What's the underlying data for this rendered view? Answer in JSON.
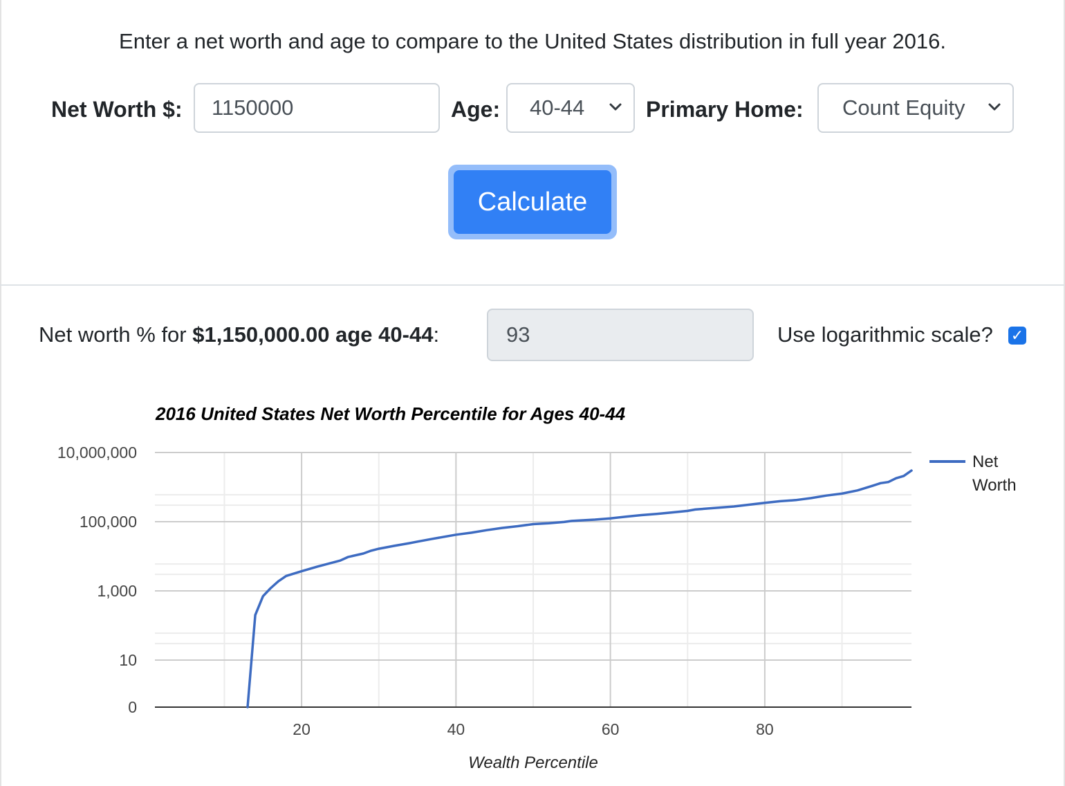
{
  "intro": "Enter a net worth and age to compare to the United States distribution in full year 2016.",
  "form": {
    "net_worth_label": "Net Worth $:",
    "net_worth_value": "1150000",
    "age_label": "Age:",
    "age_value": "40-44",
    "home_label": "Primary Home:",
    "home_value": "Count Equity",
    "calculate_label": "Calculate"
  },
  "result": {
    "prefix": "Net worth % for ",
    "amount": "$1,150,000.00",
    "age_text": " age 40-44",
    "suffix": ":",
    "percentile": "93",
    "log_label": "Use logarithmic scale?",
    "log_checked": true
  },
  "colors": {
    "accent": "#3180f5",
    "series": "#3d6bc1",
    "checkbox": "#1a73e8"
  },
  "chart_data": {
    "type": "line",
    "title": "2016 United States Net Worth Percentile for Ages 40-44",
    "xlabel": "Wealth Percentile",
    "ylabel": "",
    "yscale": "log",
    "xlim": [
      1,
      99
    ],
    "x_ticks": [
      20,
      40,
      60,
      80
    ],
    "y_ticks": [
      0,
      10,
      1000,
      100000,
      10000000
    ],
    "y_tick_labels": [
      "0",
      "10",
      "1,000",
      "100,000",
      "10,000,000"
    ],
    "grid": true,
    "legend_position": "right",
    "series": [
      {
        "name": "Net Worth",
        "points": [
          [
            13,
            0
          ],
          [
            14,
            200
          ],
          [
            15,
            700
          ],
          [
            16,
            1200
          ],
          [
            17,
            1900
          ],
          [
            18,
            2700
          ],
          [
            20,
            3700
          ],
          [
            22,
            5000
          ],
          [
            25,
            7500
          ],
          [
            26,
            9500
          ],
          [
            28,
            12000
          ],
          [
            29,
            14500
          ],
          [
            30,
            16500
          ],
          [
            32,
            20000
          ],
          [
            34,
            24000
          ],
          [
            35,
            26500
          ],
          [
            37,
            32000
          ],
          [
            40,
            42000
          ],
          [
            42,
            48000
          ],
          [
            44,
            57000
          ],
          [
            46,
            66000
          ],
          [
            48,
            74000
          ],
          [
            50,
            85000
          ],
          [
            52,
            90000
          ],
          [
            54,
            98000
          ],
          [
            55,
            105000
          ],
          [
            58,
            115000
          ],
          [
            60,
            125000
          ],
          [
            62,
            140000
          ],
          [
            64,
            155000
          ],
          [
            66,
            168000
          ],
          [
            68,
            185000
          ],
          [
            70,
            205000
          ],
          [
            71,
            225000
          ],
          [
            74,
            255000
          ],
          [
            76,
            275000
          ],
          [
            78,
            310000
          ],
          [
            80,
            350000
          ],
          [
            82,
            390000
          ],
          [
            84,
            420000
          ],
          [
            86,
            480000
          ],
          [
            88,
            570000
          ],
          [
            90,
            650000
          ],
          [
            92,
            800000
          ],
          [
            94,
            1100000
          ],
          [
            95,
            1300000
          ],
          [
            96,
            1400000
          ],
          [
            97,
            1800000
          ],
          [
            98,
            2100000
          ],
          [
            99,
            3000000
          ]
        ]
      }
    ]
  }
}
